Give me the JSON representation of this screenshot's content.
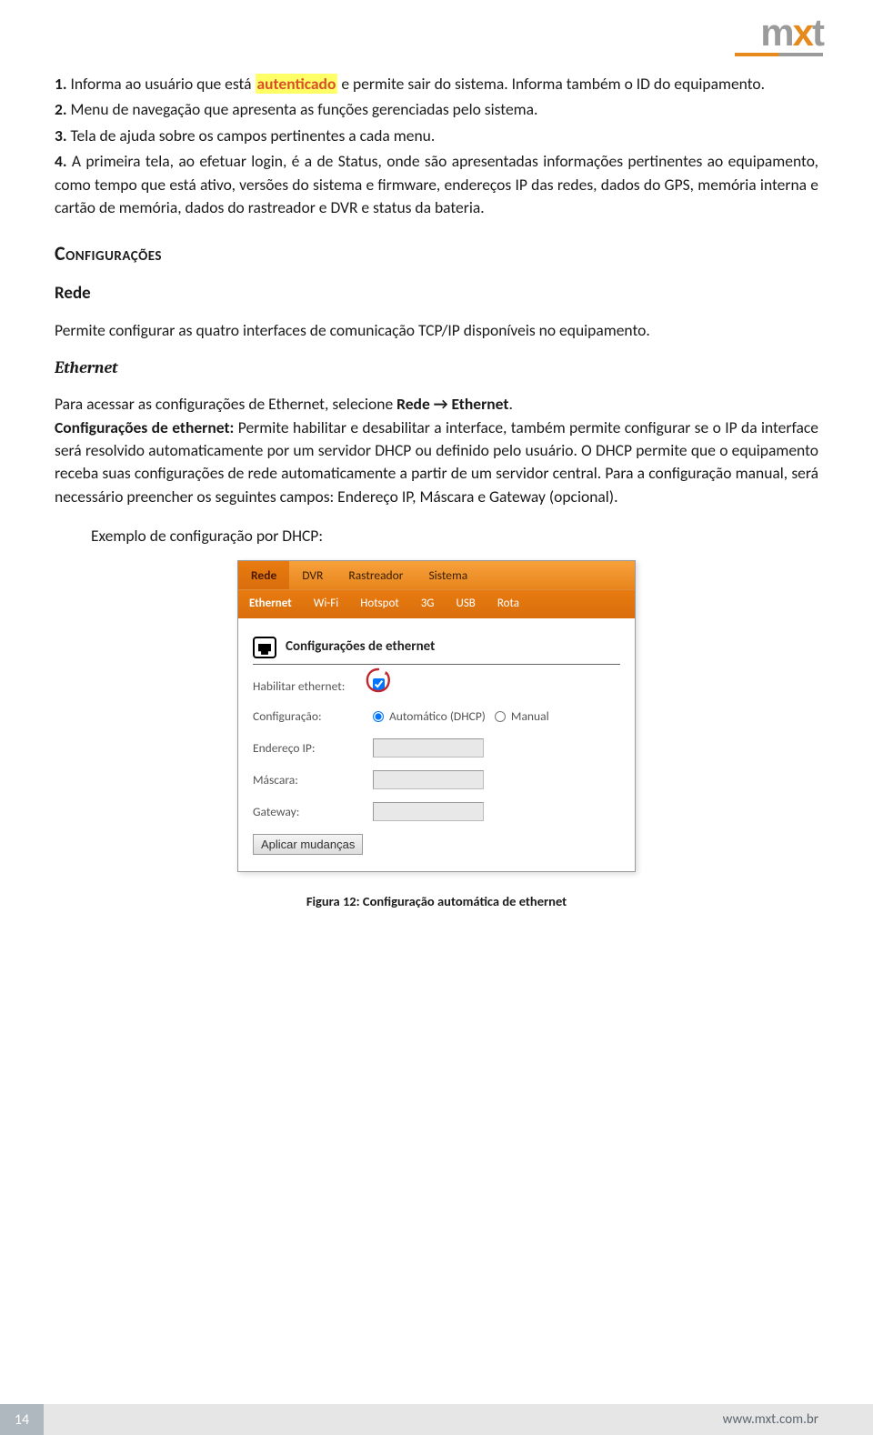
{
  "logo": {
    "m": "m",
    "x": "x",
    "t": "t"
  },
  "list": {
    "n1a": "1.",
    "n1b": "Informa ao usuário que está ",
    "n1c": "autenticado",
    "n1d": " e permite sair do sistema. Informa também o ID do equipamento.",
    "n2": "2.",
    "n2t": "Menu de navegação que apresenta as funções gerenciadas pelo sistema.",
    "n3": "3.",
    "n3t": "Tela de ajuda sobre os campos pertinentes a cada menu.",
    "n4": "4.",
    "n4t": "A primeira tela, ao efetuar login, é a de Status, onde são apresentadas informações pertinentes ao equipamento, como tempo que está ativo, versões do sistema e firmware, endereços IP das redes, dados do GPS, memória interna e cartão de memória, dados do rastreador e DVR e status da bateria."
  },
  "headings": {
    "config": "Configurações",
    "rede": "Rede",
    "ethernet": "Ethernet"
  },
  "paras": {
    "rede_intro": "Permite configurar as quatro interfaces de comunicação TCP/IP disponíveis no equipamento.",
    "eth_p1a": "Para acessar as configurações de Ethernet, selecione ",
    "eth_p1b": "Rede → Ethernet",
    "eth_p1c": ".",
    "eth_p2a": "Configurações de ethernet:",
    "eth_p2b": " Permite habilitar e desabilitar a interface, também permite configurar se o IP da interface será resolvido automaticamente por um servidor DHCP ou definido pelo usuário. O DHCP permite que o equipamento receba suas configurações de rede automaticamente a partir de um servidor central. Para a configuração manual, será necessário preencher os seguintes campos: Endereço IP, Máscara e Gateway (opcional).",
    "example": "Exemplo de configuração por DHCP:"
  },
  "ui": {
    "tabs": {
      "rede": "Rede",
      "dvr": "DVR",
      "rast": "Rastreador",
      "sist": "Sistema"
    },
    "subtabs": {
      "eth": "Ethernet",
      "wifi": "Wi-Fi",
      "hotspot": "Hotspot",
      "g3": "3G",
      "usb": "USB",
      "rota": "Rota"
    },
    "panel_title": "Configurações de ethernet",
    "labels": {
      "habilitar": "Habilitar ethernet:",
      "config": "Configuração:",
      "auto": "Automático (DHCP)",
      "manual": "Manual",
      "ip": "Endereço IP:",
      "mask": "Máscara:",
      "gw": "Gateway:"
    },
    "apply": "Aplicar mudanças"
  },
  "caption": "Figura 12: Configuração automática de ethernet",
  "footer": {
    "page": "14",
    "url": "www.mxt.com.br"
  }
}
